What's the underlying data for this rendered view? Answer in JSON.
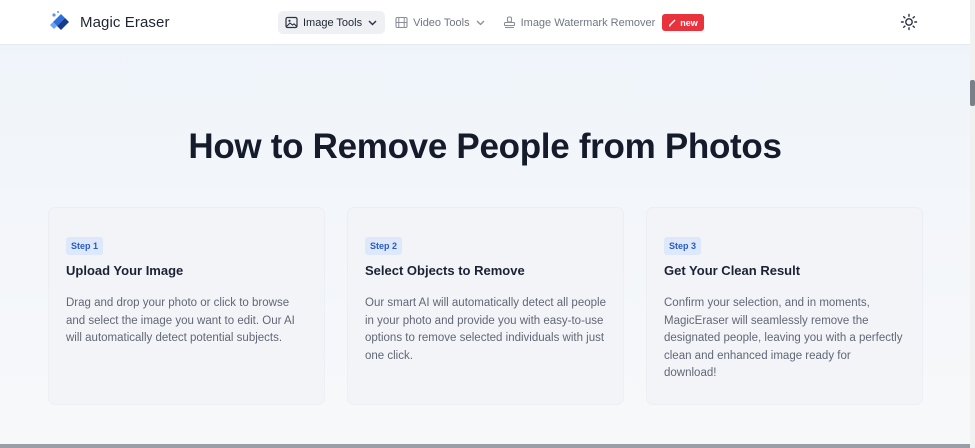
{
  "brand": {
    "name": "Magic Eraser",
    "logo_icon": "brand-logo-icon"
  },
  "nav": {
    "items": [
      {
        "label": "Image Tools",
        "icon": "image-icon",
        "active": true,
        "dropdown": true
      },
      {
        "label": "Video Tools",
        "icon": "film-icon",
        "active": false,
        "dropdown": true
      },
      {
        "label": "Image Watermark Remover",
        "icon": "stamp-icon",
        "active": false,
        "dropdown": false
      }
    ],
    "new_badge": "new"
  },
  "theme_toggle_icon": "sun-icon",
  "hero": {
    "title": "How to Remove People from Photos"
  },
  "steps": [
    {
      "badge": "Step 1",
      "title": "Upload Your Image",
      "description": "Drag and drop your photo or click to browse and select the image you want to edit. Our AI will automatically detect potential subjects."
    },
    {
      "badge": "Step 2",
      "title": "Select Objects to Remove",
      "description": "Our smart AI will automatically detect all people in your photo and provide you with easy-to-use options to remove selected individuals with just one click."
    },
    {
      "badge": "Step 3",
      "title": "Get Your Clean Result",
      "description": "Confirm your selection, and in moments, MagicEraser will seamlessly remove the designated people, leaving you with a perfectly clean and enhanced image ready for download!"
    }
  ],
  "colors": {
    "accent_blue": "#2a5bc4",
    "badge_bg": "#dde8fb",
    "new_badge_red": "#e8323c"
  }
}
